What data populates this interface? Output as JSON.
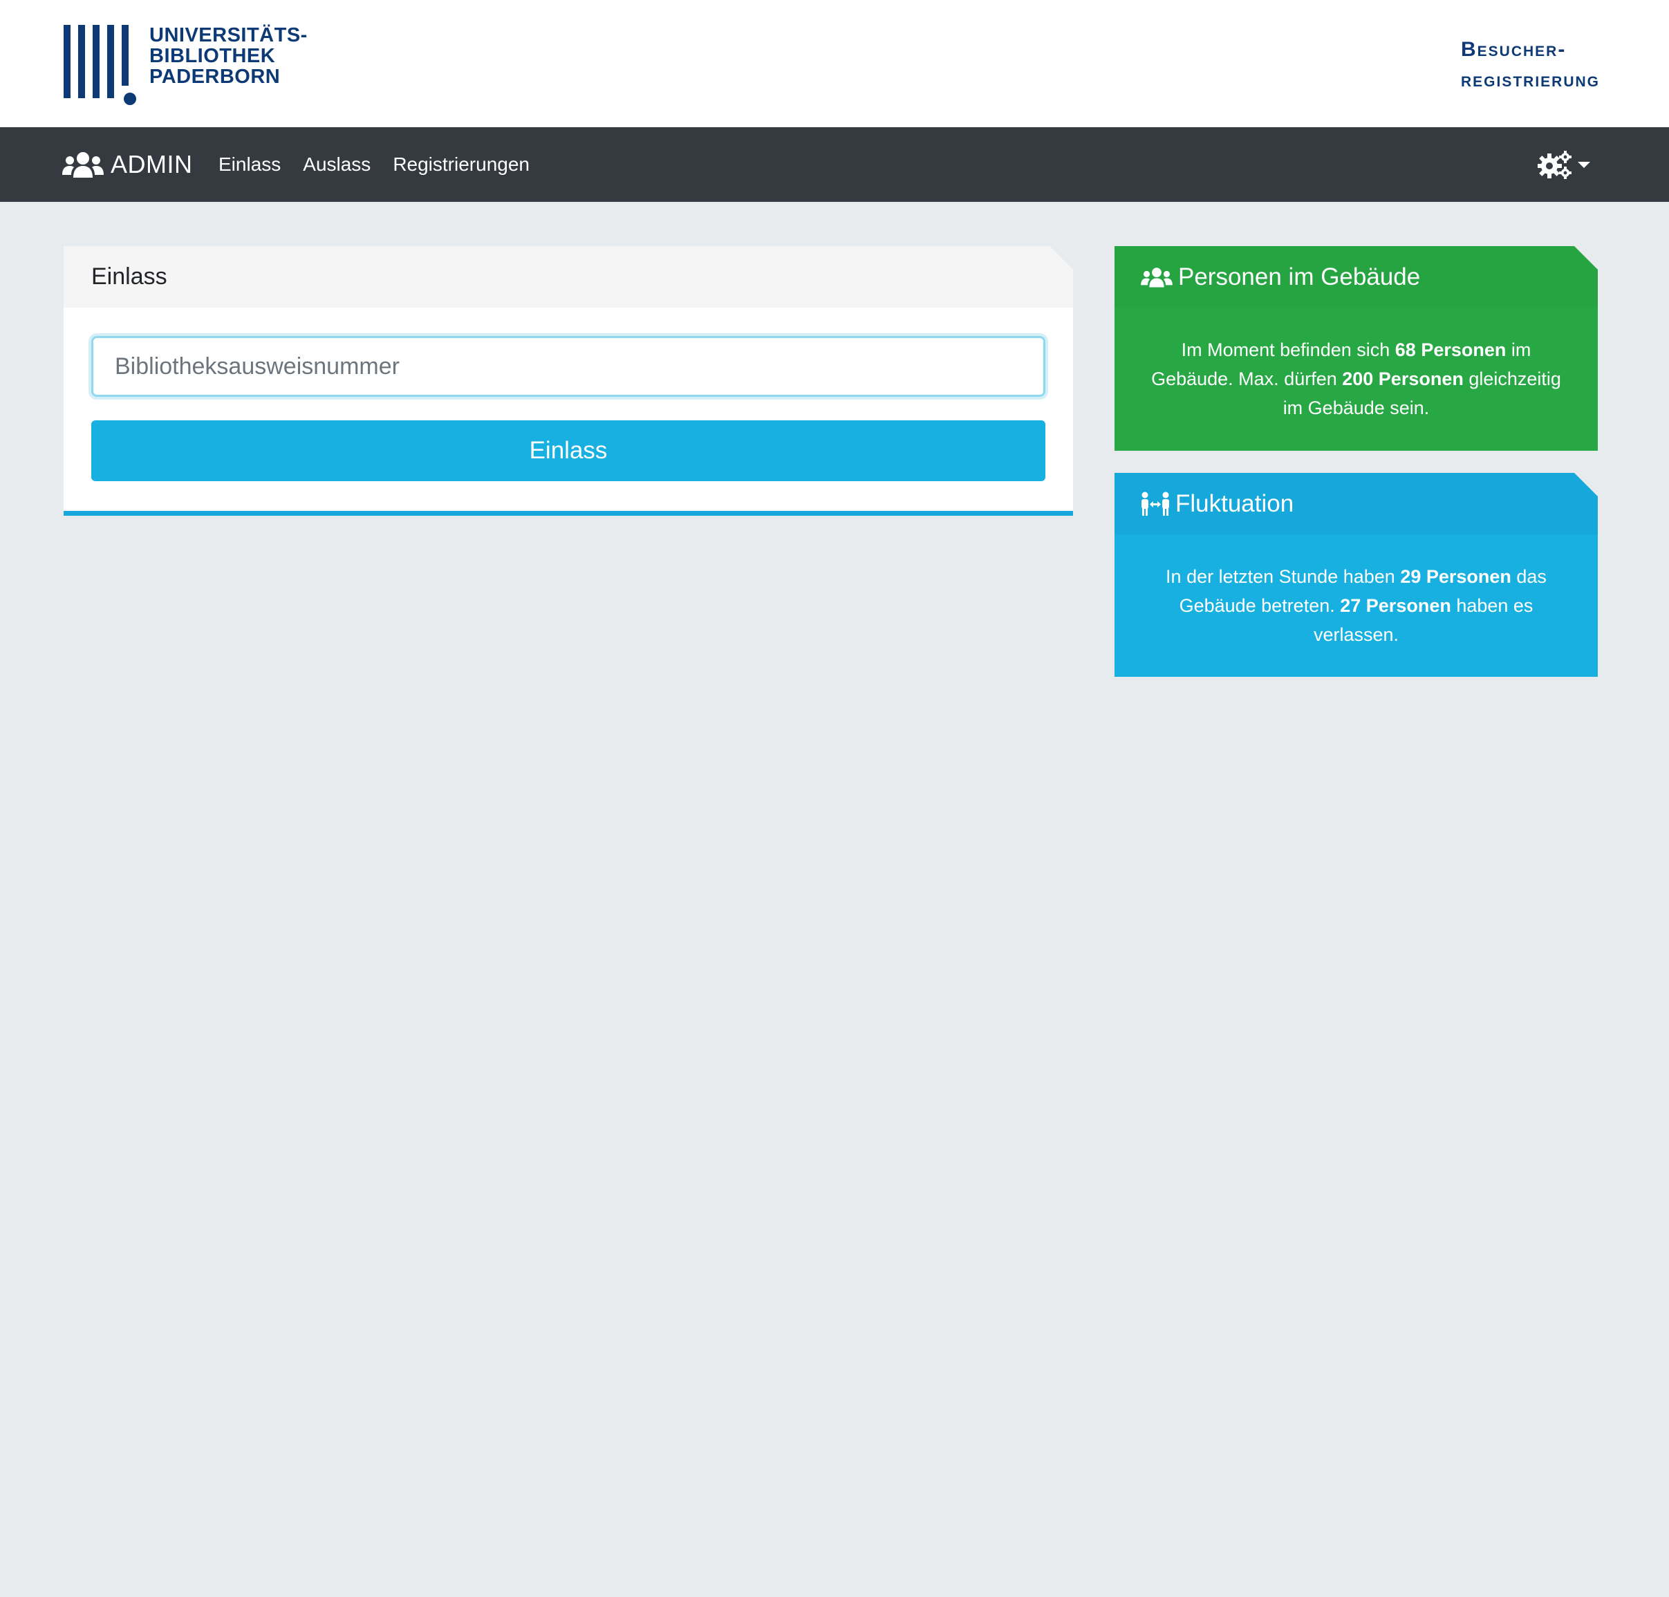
{
  "logo": {
    "line1": "UNIVERSITÄTS-",
    "line2": "BIBLIOTHEK",
    "line3": "PADERBORN"
  },
  "app_title": {
    "line1": "Besucher-",
    "line2": "registrierung"
  },
  "navbar": {
    "brand": "ADMIN",
    "links": [
      "Einlass",
      "Auslass",
      "Registrierungen"
    ],
    "settings_icon": "gears-icon"
  },
  "main_card": {
    "title": "Einlass",
    "input_placeholder": "Bibliotheksausweisnummer",
    "input_value": "",
    "button_label": "Einlass"
  },
  "occupancy_card": {
    "title": "Personen im Gebäude",
    "icon": "users-icon",
    "text_1": "Im Moment befinden sich ",
    "current": "68 Personen",
    "text_2": " im Gebäude. Max. dürfen ",
    "max": "200 Personen",
    "text_3": " gleichzeitig im Gebäude sein.",
    "color": "#28a745"
  },
  "fluctuation_card": {
    "title": "Fluktuation",
    "icon": "people-arrows-icon",
    "text_1": "In der letzten Stunde haben ",
    "entered": "29 Personen",
    "text_2": " das Gebäude betreten. ",
    "left": "27 Personen",
    "text_3": " haben es verlassen.",
    "color": "#17b0e0"
  }
}
